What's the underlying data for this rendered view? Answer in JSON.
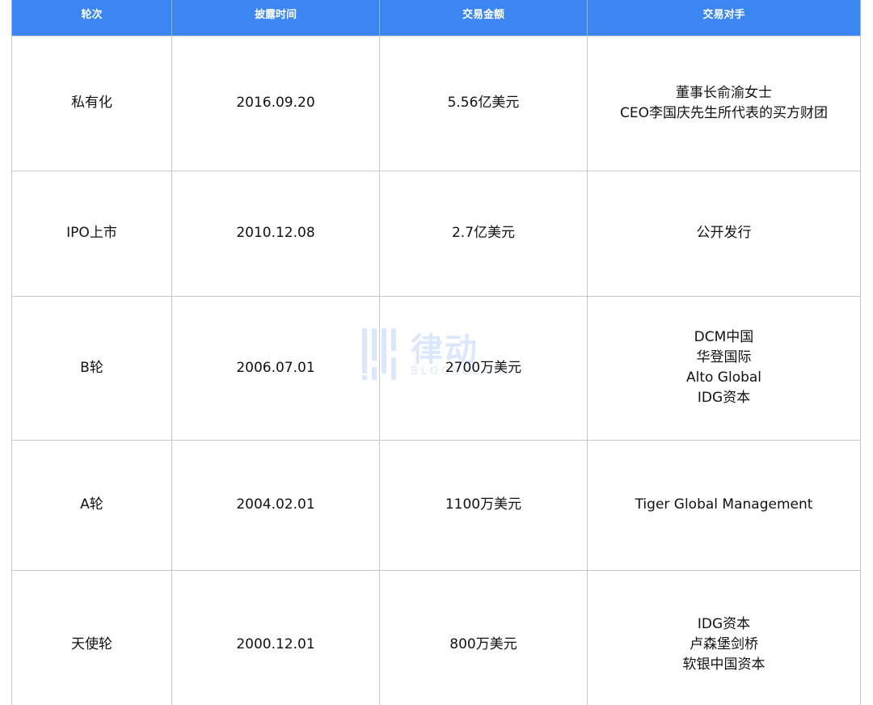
{
  "table": {
    "headers": [
      "轮次",
      "披露时间",
      "交易金额",
      "交易对手"
    ],
    "rows": [
      {
        "round": "私有化",
        "date": "2016.09.20",
        "amount": "5.56亿美元",
        "counterparties": [
          "董事长俞渝女士",
          "CEO李国庆先生所代表的买方财团"
        ]
      },
      {
        "round": "IPO上市",
        "date": "2010.12.08",
        "amount": "2.7亿美元",
        "counterparties": [
          "公开发行"
        ]
      },
      {
        "round": "B轮",
        "date": "2006.07.01",
        "amount": "2700万美元",
        "counterparties": [
          "DCM中国",
          "华登国际",
          "Alto Global",
          "IDG资本"
        ]
      },
      {
        "round": "A轮",
        "date": "2004.02.01",
        "amount": "1100万美元",
        "counterparties": [
          "Tiger Global Management"
        ]
      },
      {
        "round": "天使轮",
        "date": "2000.12.01",
        "amount": "800万美元",
        "counterparties": [
          "IDG资本",
          "卢森堡剑桥",
          "软银中国资本"
        ]
      }
    ]
  },
  "watermark": {
    "text": "律动",
    "sub": "BLOCKBEATS",
    "icon": "bars-logo-icon"
  },
  "colors": {
    "header_bg": "#3b86f0",
    "header_text": "#ffffff",
    "grid": "#c8c8c8"
  }
}
